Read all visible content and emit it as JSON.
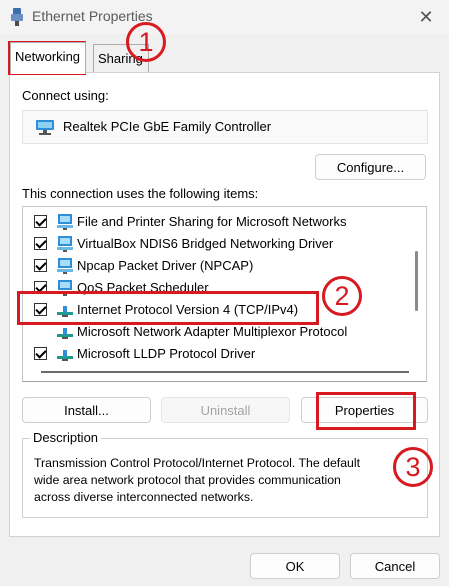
{
  "window": {
    "title": "Ethernet Properties",
    "close_glyph": "✕",
    "icon": "ethernet-adapter-icon"
  },
  "tabs": [
    {
      "label": "Networking",
      "active": true
    },
    {
      "label": "Sharing",
      "active": false
    }
  ],
  "connect_using_label": "Connect using:",
  "adapter": {
    "name": "Realtek PCIe GbE Family Controller",
    "icon": "network-adapter-icon"
  },
  "buttons": {
    "configure": "Configure...",
    "install": "Install...",
    "uninstall": "Uninstall",
    "properties": "Properties",
    "ok": "OK",
    "cancel": "Cancel"
  },
  "items_label": "This connection uses the following items:",
  "items": [
    {
      "label": "File and Printer Sharing for Microsoft Networks",
      "checked": true,
      "icon": "client-service-icon"
    },
    {
      "label": "VirtualBox NDIS6 Bridged Networking Driver",
      "checked": true,
      "icon": "client-service-icon"
    },
    {
      "label": "Npcap Packet Driver (NPCAP)",
      "checked": true,
      "icon": "client-service-icon"
    },
    {
      "label": "QoS Packet Scheduler",
      "checked": true,
      "icon": "client-service-icon"
    },
    {
      "label": "Internet Protocol Version 4 (TCP/IPv4)",
      "checked": true,
      "icon": "protocol-icon"
    },
    {
      "label": "Microsoft Network Adapter Multiplexor Protocol",
      "checked": false,
      "icon": "protocol-icon"
    },
    {
      "label": "Microsoft LLDP Protocol Driver",
      "checked": true,
      "icon": "protocol-icon"
    }
  ],
  "description": {
    "title": "Description",
    "text": "Transmission Control Protocol/Internet Protocol. The default\nwide area network protocol that provides communication\nacross diverse interconnected networks."
  },
  "annotations": [
    {
      "number": "1"
    },
    {
      "number": "2"
    },
    {
      "number": "3"
    }
  ],
  "colors": {
    "annotation": "#d71920",
    "client_icon": "#2e8fd8",
    "protocol_icon": "#1f9a8a"
  }
}
